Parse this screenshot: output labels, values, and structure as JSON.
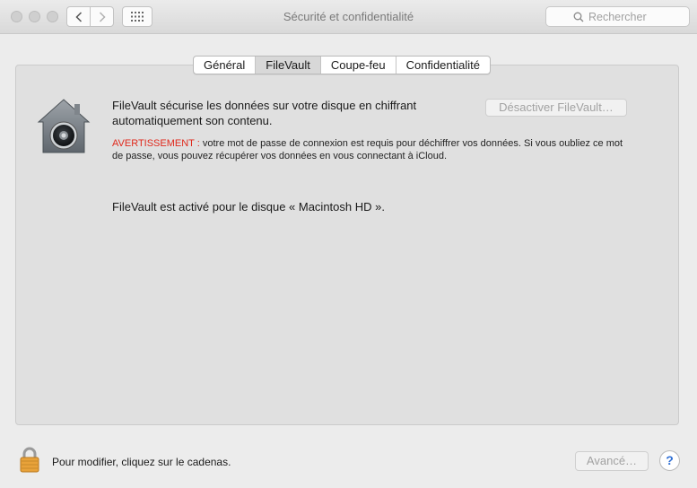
{
  "window": {
    "title": "Sécurité et confidentialité"
  },
  "toolbar": {
    "back_icon": "chevron-left-icon",
    "forward_icon": "chevron-right-icon",
    "grid_icon": "grid-icon"
  },
  "search": {
    "placeholder": "Rechercher"
  },
  "tabs": [
    {
      "label": "Général"
    },
    {
      "label": "FileVault",
      "selected": true
    },
    {
      "label": "Coupe-feu"
    },
    {
      "label": "Confidentialité"
    }
  ],
  "filevault": {
    "description": "FileVault sécurise les données sur votre disque en chiffrant automatiquement son contenu.",
    "warning_label": "AVERTISSEMENT :",
    "warning_text": " votre mot de passe de connexion est requis pour déchiffrer vos données. Si vous oubliez ce mot de passe, vous pouvez récupérer vos données en vous connectant à iCloud.",
    "disable_button": "Désactiver FileVault…",
    "status": "FileVault est activé pour le disque « Macintosh HD »."
  },
  "footer": {
    "lock_text": "Pour modifier, cliquez sur le cadenas.",
    "advanced_button": "Avancé…",
    "help_button": "?"
  },
  "colors": {
    "warning": "#e0281b",
    "lock": "#e8a23a",
    "help": "#2f6fd4"
  }
}
